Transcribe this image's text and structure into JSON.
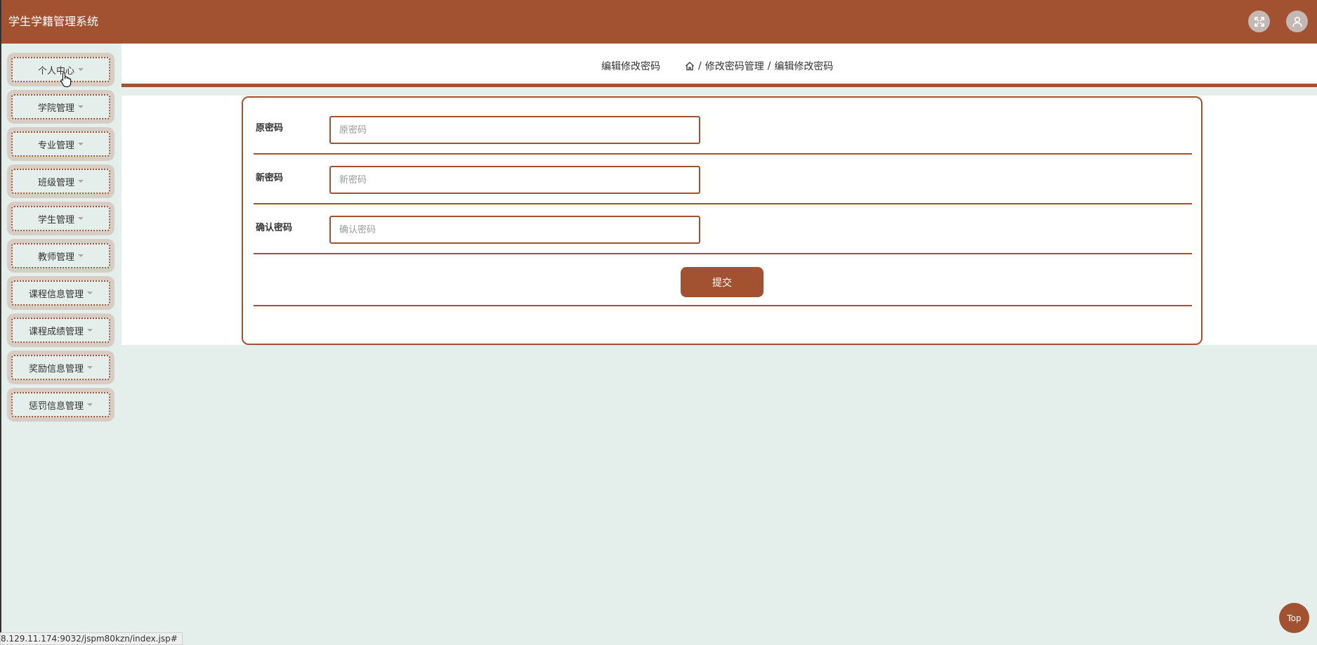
{
  "app": {
    "title": "学生学籍管理系统"
  },
  "header": {
    "icons": [
      "fullscreen-icon",
      "user-icon"
    ]
  },
  "sidebar": {
    "items": [
      {
        "label": "个人中心"
      },
      {
        "label": "学院管理"
      },
      {
        "label": "专业管理"
      },
      {
        "label": "班级管理"
      },
      {
        "label": "学生管理"
      },
      {
        "label": "教师管理"
      },
      {
        "label": "课程信息管理"
      },
      {
        "label": "课程成绩管理"
      },
      {
        "label": "奖励信息管理"
      },
      {
        "label": "惩罚信息管理"
      }
    ]
  },
  "content": {
    "title": "编辑修改密码",
    "breadcrumb": {
      "sep": "/",
      "level1": "修改密码管理",
      "level2": "编辑修改密码"
    }
  },
  "form": {
    "old_password": {
      "label": "原密码",
      "placeholder": "原密码",
      "value": ""
    },
    "new_password": {
      "label": "新密码",
      "placeholder": "新密码",
      "value": ""
    },
    "confirm_password": {
      "label": "确认密码",
      "placeholder": "确认密码",
      "value": ""
    },
    "submit_label": "提交"
  },
  "status_bar": {
    "url": "8.129.11.174:9032/jspm80kzn/index.jsp#"
  },
  "back_to_top": {
    "label": "Top"
  },
  "colors": {
    "brand": "#a25230",
    "background": "#e4efeb",
    "menu_bg": "#d8cdc5"
  }
}
